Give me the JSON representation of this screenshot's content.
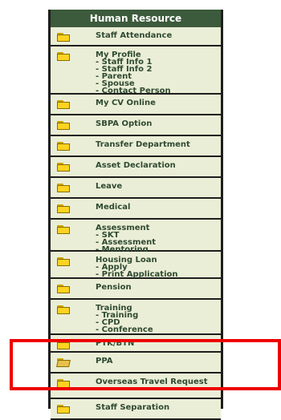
{
  "menu": {
    "title": "Human Resource",
    "items": [
      {
        "label": "Staff Attendance",
        "sub": [],
        "icon": "folder-icon",
        "h": 24
      },
      {
        "label": "My Profile",
        "sub": [
          "- Staff Info 1",
          "- Staff Info 2",
          "- Parent",
          "- Spouse",
          "- Contact Person"
        ],
        "icon": "folder-icon",
        "h": 60
      },
      {
        "label": "My CV Online",
        "sub": [],
        "icon": "folder-icon",
        "h": 26
      },
      {
        "label": "SBPA Option",
        "sub": [],
        "icon": "folder-icon",
        "h": 26
      },
      {
        "label": "Transfer Department",
        "sub": [],
        "icon": "folder-icon",
        "h": 26
      },
      {
        "label": "Asset Declaration",
        "sub": [],
        "icon": "folder-icon",
        "h": 26
      },
      {
        "label": "Leave",
        "sub": [],
        "icon": "folder-icon",
        "h": 26
      },
      {
        "label": "Medical",
        "sub": [],
        "icon": "folder-icon",
        "h": 26
      },
      {
        "label": "Assessment",
        "sub": [
          "- SKT",
          "- Assessment",
          "- Mentoring"
        ],
        "icon": "folder-icon",
        "h": 40
      },
      {
        "label": "Housing Loan",
        "sub": [
          "- Apply",
          "- Print Application"
        ],
        "icon": "folder-icon",
        "h": 34
      },
      {
        "label": "Pension",
        "sub": [],
        "icon": "folder-icon",
        "h": 26
      },
      {
        "label": "Training",
        "sub": [
          "- Training",
          "- CPD",
          "- Conference"
        ],
        "icon": "folder-icon",
        "h": 44
      },
      {
        "label": "PTK/BTN",
        "sub": [],
        "icon": "folder-icon",
        "h": 22
      },
      {
        "label": "PPA",
        "sub": [],
        "icon": "open-folder-icon",
        "h": 26
      },
      {
        "label": "Overseas Travel Request",
        "sub": [],
        "icon": "folder-icon",
        "h": 32
      },
      {
        "label": "Staff Separation",
        "sub": [],
        "icon": "folder-icon",
        "h": 26
      }
    ]
  },
  "colors": {
    "header_bg": "#3c5a3c",
    "item_bg": "#ebeed6",
    "text": "#2f4a32",
    "highlight": "#ee0000"
  }
}
